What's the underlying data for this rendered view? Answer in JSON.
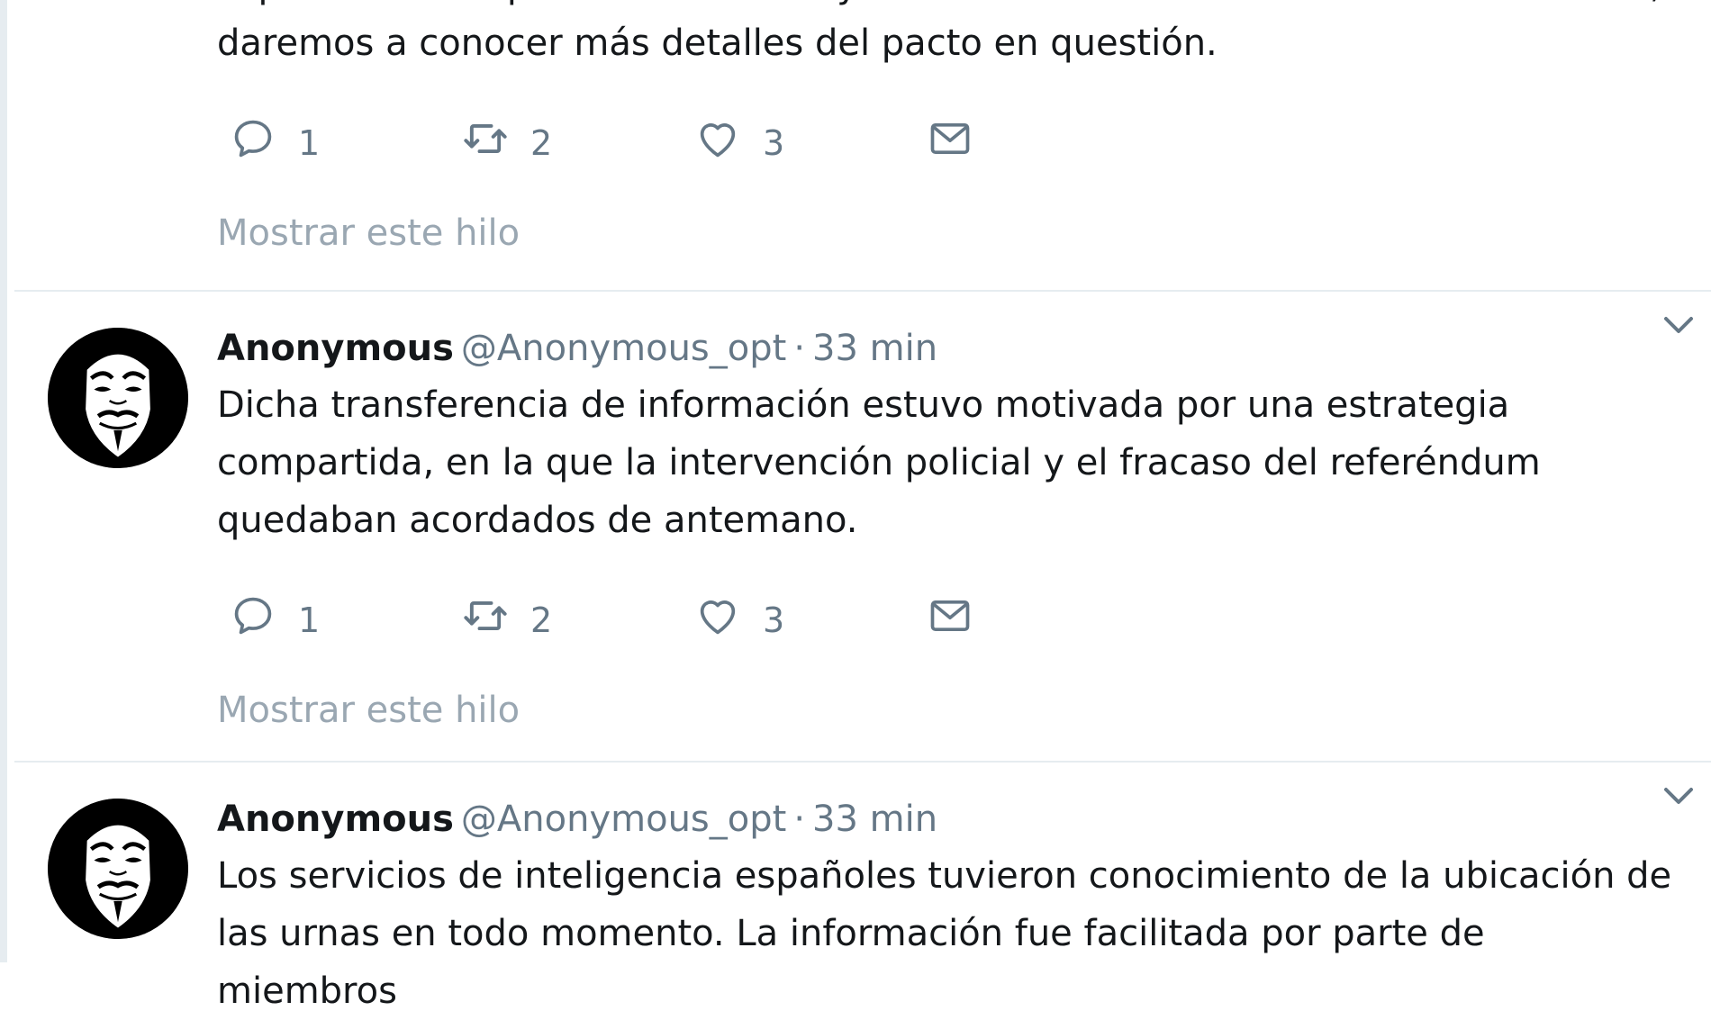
{
  "tweets": [
    {
      "text_lines": [
        "espontánea del pueblo de Catalunya en los centros de votación. Próximamente,",
        "daremos a conocer más detalles del pacto en questión."
      ],
      "reply_count": "1",
      "retweet_count": "2",
      "like_count": "3",
      "show_thread": "Mostrar este hilo"
    },
    {
      "name": "Anonymous",
      "handle": "@Anonymous_opt",
      "separator": "·",
      "time": "33 min",
      "text_lines": [
        "Dicha transferencia de información estuvo motivada por una estrategia",
        "compartida, en la que la intervención policial y el fracaso del referéndum",
        "quedaban acordados de antemano."
      ],
      "reply_count": "1",
      "retweet_count": "2",
      "like_count": "3",
      "show_thread": "Mostrar este hilo"
    },
    {
      "name": "Anonymous",
      "handle": "@Anonymous_opt",
      "separator": "·",
      "time": "33 min",
      "text_lines": [
        "Los servicios de inteligencia españoles tuvieron conocimiento de la ubicación de",
        "las urnas en todo momento. La información fue facilitada por parte de miembros"
      ]
    }
  ],
  "icons": {
    "reply": "reply-icon",
    "retweet": "retweet-icon",
    "like": "heart-icon",
    "dm": "envelope-icon",
    "caret": "chevron-down-icon",
    "avatar": "guy-fawkes-mask-avatar"
  },
  "colors": {
    "text": "#14171a",
    "muted": "#657786",
    "show_thread": "#9aa7b2",
    "divider": "#e6ecf0"
  }
}
